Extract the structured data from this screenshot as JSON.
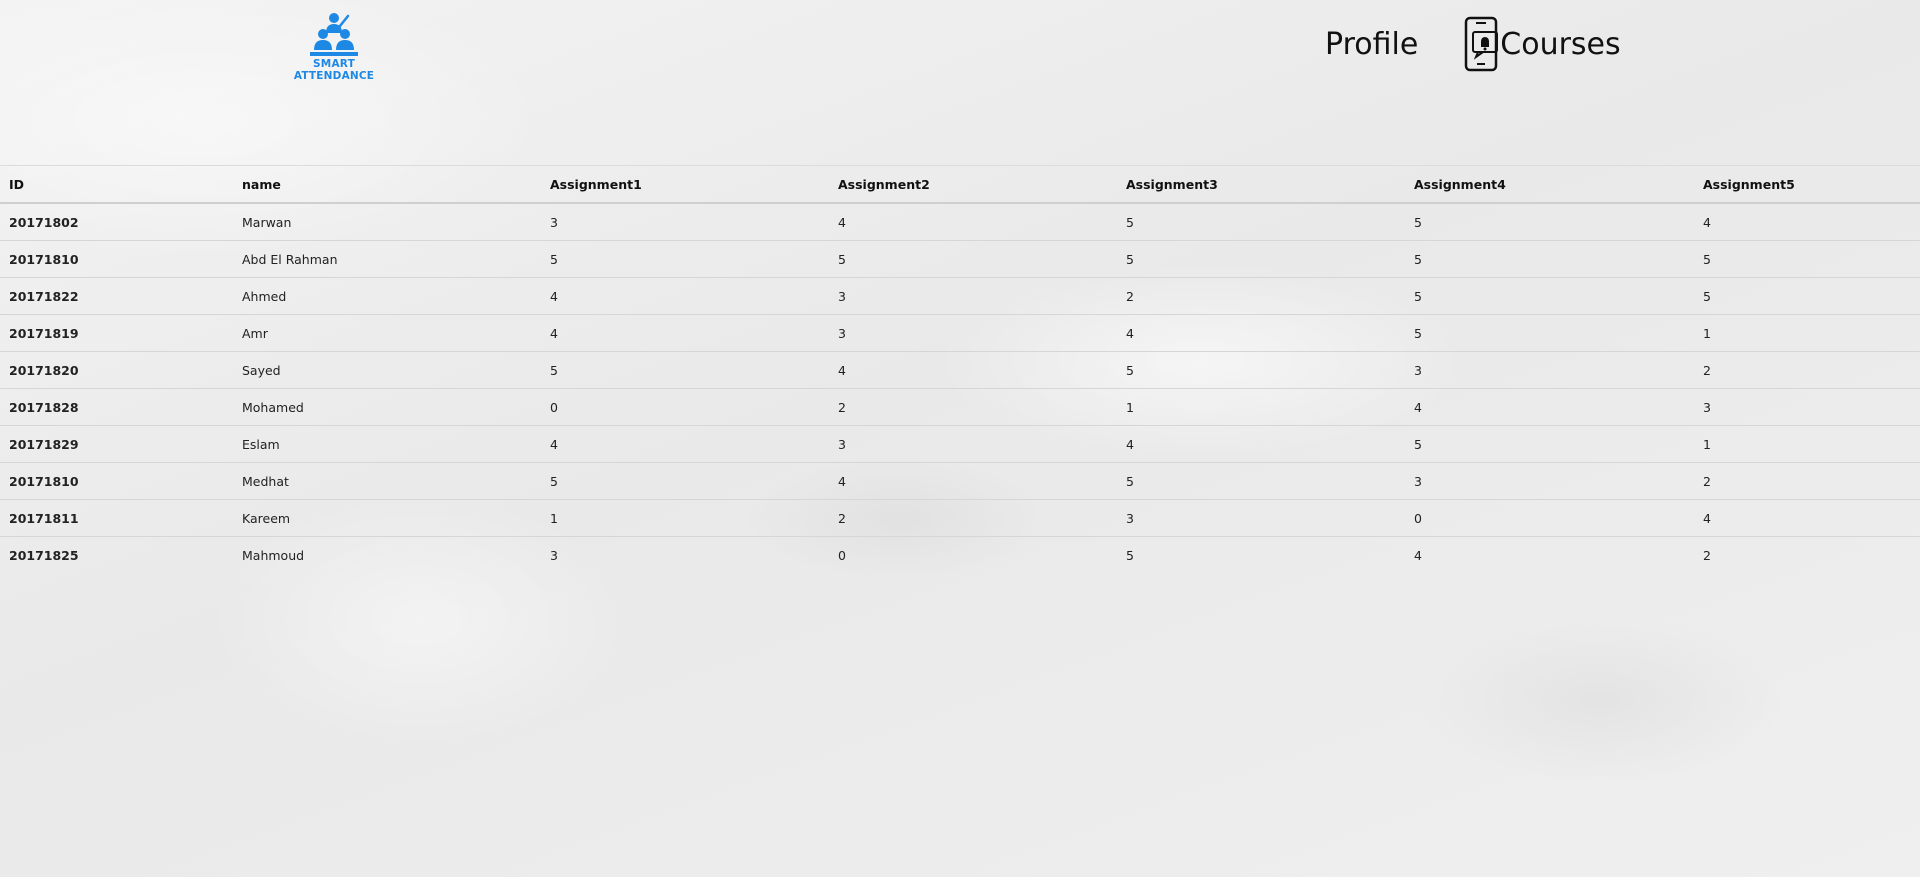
{
  "brand": {
    "logo_text_line1": "SMART",
    "logo_text_line2": "ATTENDANCE",
    "color": "#1e88e5"
  },
  "nav": {
    "profile_label": "Profile",
    "courses_label": "Courses",
    "courses_icon": "phone-notification-icon"
  },
  "table": {
    "headers": [
      "ID",
      "name",
      "Assignment1",
      "Assignment2",
      "Assignment3",
      "Assignment4",
      "Assignment5"
    ],
    "rows": [
      [
        "20171802",
        "Marwan",
        "3",
        "4",
        "5",
        "5",
        "4"
      ],
      [
        "20171810",
        "Abd El Rahman",
        "5",
        "5",
        "5",
        "5",
        "5"
      ],
      [
        "20171822",
        "Ahmed",
        "4",
        "3",
        "2",
        "5",
        "5"
      ],
      [
        "20171819",
        "Amr",
        "4",
        "3",
        "4",
        "5",
        "1"
      ],
      [
        "20171820",
        "Sayed",
        "5",
        "4",
        "5",
        "3",
        "2"
      ],
      [
        "20171828",
        "Mohamed",
        "0",
        "2",
        "1",
        "4",
        "3"
      ],
      [
        "20171829",
        "Eslam",
        "4",
        "3",
        "4",
        "5",
        "1"
      ],
      [
        "20171810",
        "Medhat",
        "5",
        "4",
        "5",
        "3",
        "2"
      ],
      [
        "20171811",
        "Kareem",
        "1",
        "2",
        "3",
        "0",
        "4"
      ],
      [
        "20171825",
        "Mahmoud",
        "3",
        "0",
        "5",
        "4",
        "2"
      ]
    ]
  }
}
